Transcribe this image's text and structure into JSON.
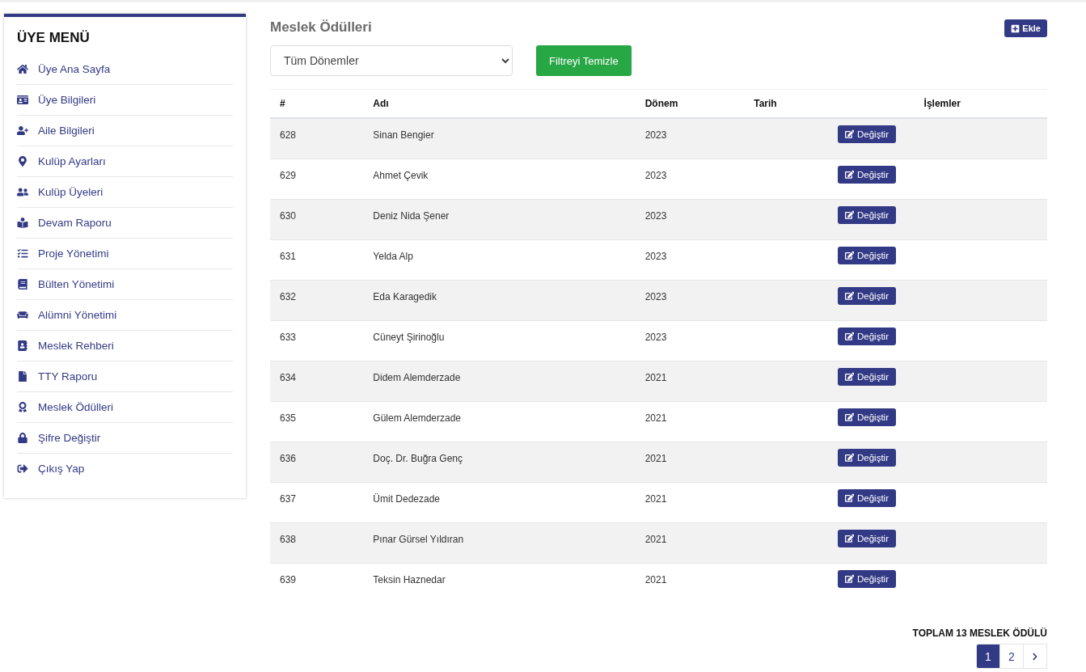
{
  "sidebar": {
    "title": "ÜYE MENÜ",
    "items": [
      {
        "label": "Üye Ana Sayfa"
      },
      {
        "label": "Üye Bilgileri"
      },
      {
        "label": "Aile Bilgileri"
      },
      {
        "label": "Kulüp Ayarları"
      },
      {
        "label": "Kulüp Üyeleri"
      },
      {
        "label": "Devam Raporu"
      },
      {
        "label": "Proje Yönetimi"
      },
      {
        "label": "Bülten Yönetimi"
      },
      {
        "label": "Alümni Yönetimi"
      },
      {
        "label": "Meslek Rehberi"
      },
      {
        "label": "TTY Raporu"
      },
      {
        "label": "Meslek Ödülleri"
      },
      {
        "label": "Şifre Değiştir"
      },
      {
        "label": "Çıkış Yap"
      }
    ]
  },
  "page": {
    "title": "Meslek Ödülleri",
    "add_button": "Ekle",
    "filter": {
      "value": "Tüm Dönemler"
    },
    "clear_button": "Filtreyi Temizle"
  },
  "table": {
    "columns": [
      "#",
      "Adı",
      "Dönem",
      "Tarih",
      "İşlemler"
    ],
    "rows": [
      {
        "id": "628",
        "name": "Sinan Bengier",
        "period": "2023",
        "action": "Değiştir"
      },
      {
        "id": "629",
        "name": "Ahmet Çevik",
        "period": "2023",
        "action": "Değiştir"
      },
      {
        "id": "630",
        "name": "Deniz Nida Şener",
        "period": "2023",
        "action": "Değiştir"
      },
      {
        "id": "631",
        "name": "Yelda Alp",
        "period": "2023",
        "action": "Değiştir"
      },
      {
        "id": "632",
        "name": "Eda Karagedik",
        "period": "2023",
        "action": "Değiştir"
      },
      {
        "id": "633",
        "name": "Cüneyt Şirinoğlu",
        "period": "2023",
        "action": "Değiştir"
      },
      {
        "id": "634",
        "name": "Didem Alemderzade",
        "period": "2021",
        "action": "Değiştir"
      },
      {
        "id": "635",
        "name": "Gülem Alemderzade",
        "period": "2021",
        "action": "Değiştir"
      },
      {
        "id": "636",
        "name": "Doç. Dr. Buğra Genç",
        "period": "2021",
        "action": "Değiştir"
      },
      {
        "id": "637",
        "name": "Ümit Dedezade",
        "period": "2021",
        "action": "Değiştir"
      },
      {
        "id": "638",
        "name": "Pınar Gürsel Yıldıran",
        "period": "2021",
        "action": "Değiştir"
      },
      {
        "id": "639",
        "name": "Teksin Haznedar",
        "period": "2021",
        "action": "Değiştir"
      }
    ]
  },
  "total": "TOPLAM 13 MESLEK ÖDÜLÜ",
  "pagination": {
    "pages": [
      {
        "label": "1",
        "selected": true
      },
      {
        "label": "2",
        "selected": false
      }
    ]
  }
}
